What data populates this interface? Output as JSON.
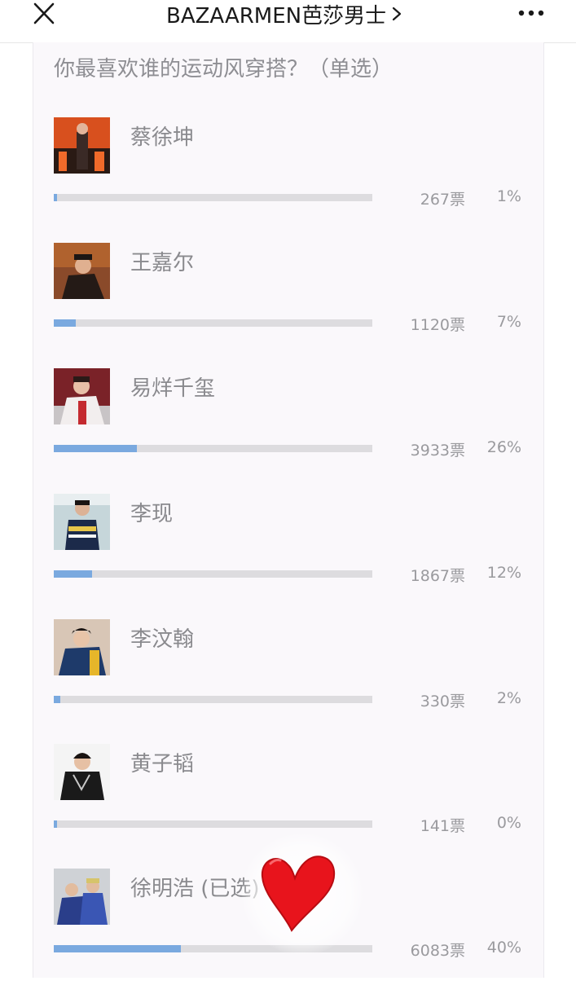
{
  "header": {
    "title": "BAZAARMEN芭莎男士",
    "close_icon": "close-icon",
    "more_icon": "more-icon",
    "chevron_icon": "chevron-right-icon"
  },
  "poll": {
    "question": "你最喜欢谁的运动风穿搭？（单选）",
    "bar_color": "#7aa9df",
    "track_color": "#dddcdf",
    "options": [
      {
        "name": "蔡徐坤",
        "votes": "267票",
        "percent": "1%",
        "fill": 0.01
      },
      {
        "name": "王嘉尔",
        "votes": "1120票",
        "percent": "7%",
        "fill": 0.07
      },
      {
        "name": "易烊千玺",
        "votes": "3933票",
        "percent": "26%",
        "fill": 0.26
      },
      {
        "name": "李现",
        "votes": "1867票",
        "percent": "12%",
        "fill": 0.12
      },
      {
        "name": "李汶翰",
        "votes": "330票",
        "percent": "2%",
        "fill": 0.02
      },
      {
        "name": "黄子韬",
        "votes": "141票",
        "percent": "0%",
        "fill": 0.0
      },
      {
        "name": "徐明浩 (已选)",
        "votes": "6083票",
        "percent": "40%",
        "fill": 0.4
      }
    ]
  },
  "sticker": {
    "icon": "heart-icon",
    "color": "#e8141c"
  }
}
